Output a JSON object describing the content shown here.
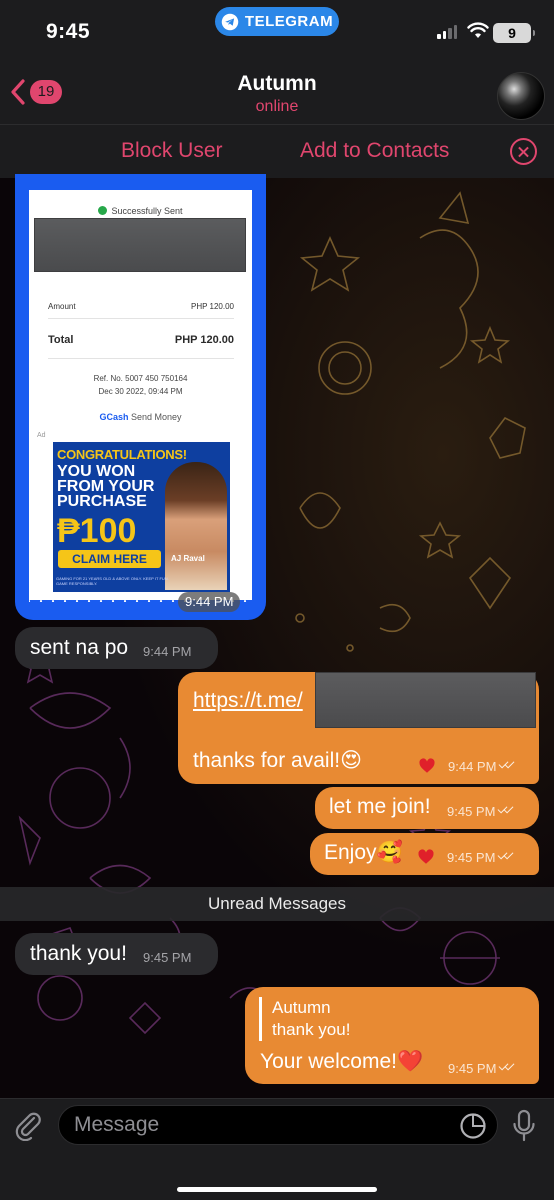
{
  "status_bar": {
    "time": "9:45",
    "app_pill": "TELEGRAM",
    "battery": "9"
  },
  "header": {
    "back_count": "19",
    "title": "Autumn",
    "subtitle": "online"
  },
  "action_bar": {
    "block_user": "Block User",
    "add_to_contacts": "Add to Contacts"
  },
  "receipt": {
    "status": "Successfully Sent",
    "amount_label": "Amount",
    "amount_value": "PHP 120.00",
    "total_label": "Total",
    "total_value": "PHP 120.00",
    "ref_line": "Ref. No. 5007 450 750164",
    "date_line": "Dec 30 2022, 09:44 PM",
    "gcash_brand": "GCash",
    "gcash_label": "Send Money",
    "ad_label": "Ad",
    "ad": {
      "line1": "CONGRATULATIONS!",
      "line2": "YOU WON FROM YOUR PURCHASE",
      "amount": "₱100",
      "cta": "CLAIM HERE",
      "name": "AJ Raval",
      "fine_print": "GAMING FOR 21 YEARS OLD & ABOVE ONLY. KEEP IT FUN. GAME RESPONSIBLY."
    },
    "time": "9:44 PM"
  },
  "messages": [
    {
      "id": "m1",
      "direction": "incoming",
      "text": "sent na po",
      "time": "9:44 PM"
    },
    {
      "id": "m2",
      "direction": "outgoing",
      "link": "https://t.me/",
      "text": "thanks for avail!😍",
      "time": "9:44 PM",
      "reaction": "heart"
    },
    {
      "id": "m3",
      "direction": "outgoing",
      "text": "let me join!",
      "time": "9:45 PM"
    },
    {
      "id": "m4",
      "direction": "outgoing",
      "text": "Enjoy🥰",
      "time": "9:45 PM",
      "reaction": "heart"
    },
    {
      "id": "m5",
      "direction": "incoming",
      "text": "thank you!",
      "time": "9:45 PM"
    },
    {
      "id": "m6",
      "direction": "outgoing",
      "reply_to_name": "Autumn",
      "reply_to_text": "thank you!",
      "text": "Your welcome!❤️",
      "time": "9:45 PM"
    }
  ],
  "unread_divider": "Unread Messages",
  "input": {
    "placeholder": "Message"
  },
  "colors": {
    "accent": "#e0466e",
    "outgoing_bubble": "#e88a33",
    "incoming_bubble": "#2b2b2e",
    "telegram_blue": "#2b87e8",
    "gcash_blue": "#1a5cf0",
    "heart": "#e0202a"
  }
}
